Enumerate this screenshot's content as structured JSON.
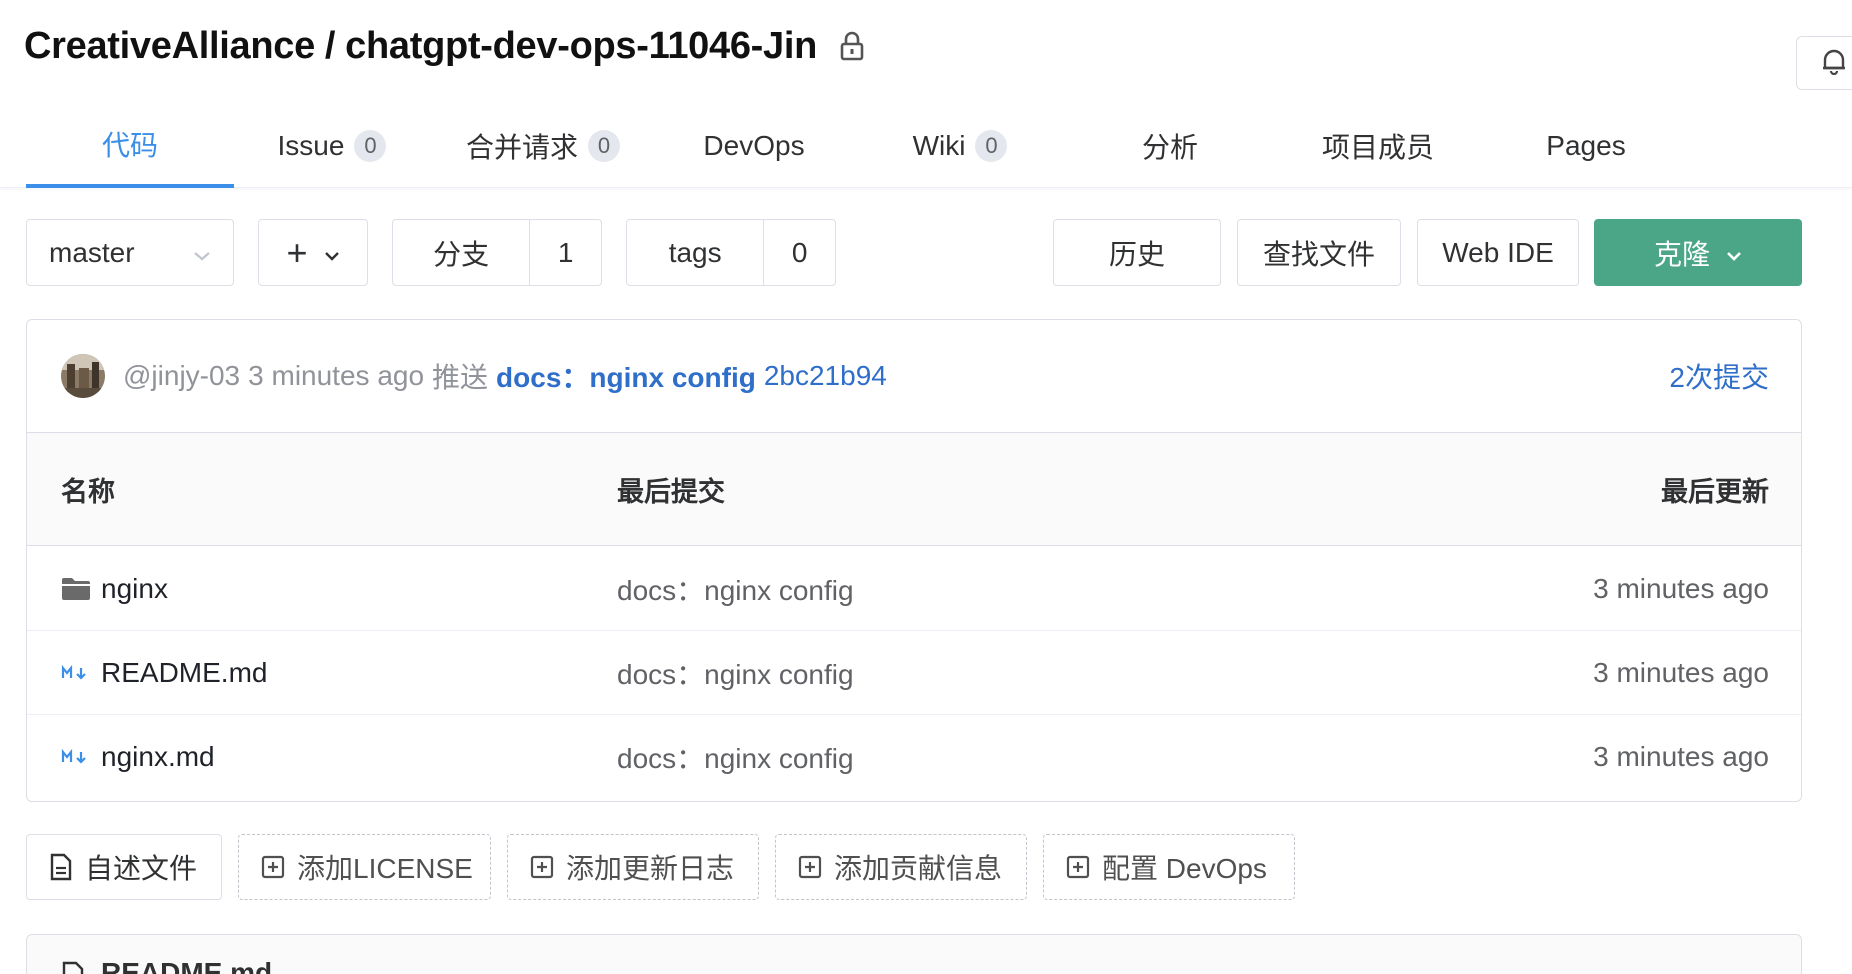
{
  "header": {
    "owner": "CreativeAlliance",
    "separator": "/",
    "repo": "chatgpt-dev-ops-11046-Jin",
    "icons": {
      "lock": "lock-icon",
      "bell": "bell-icon"
    }
  },
  "tabs": [
    {
      "label": "代码",
      "active": true
    },
    {
      "label": "Issue",
      "count": "0"
    },
    {
      "label": "合并请求",
      "count": "0"
    },
    {
      "label": "DevOps"
    },
    {
      "label": "Wiki",
      "count": "0"
    },
    {
      "label": "分析"
    },
    {
      "label": "项目成员"
    },
    {
      "label": "Pages"
    }
  ],
  "toolbar": {
    "branch": "master",
    "add_label": "+",
    "branches_label": "分支",
    "branches_count": "1",
    "tags_label": "tags",
    "tags_count": "0",
    "history": "历史",
    "find_file": "查找文件",
    "web_ide": "Web IDE",
    "clone": "克隆"
  },
  "latest_commit": {
    "author": "@jinjy-03",
    "time": "3 minutes ago",
    "verb": "推送",
    "message": "docs：nginx config",
    "sha": "2bc21b94",
    "commit_count": "2次提交"
  },
  "table": {
    "headers": {
      "name": "名称",
      "last_commit": "最后提交",
      "last_update": "最后更新"
    },
    "rows": [
      {
        "icon": "folder-icon",
        "name": "nginx",
        "commit": "docs：nginx config",
        "time": "3 minutes ago"
      },
      {
        "icon": "markdown-icon",
        "name": "README.md",
        "commit": "docs：nginx config",
        "time": "3 minutes ago"
      },
      {
        "icon": "markdown-icon",
        "name": "nginx.md",
        "commit": "docs：nginx config",
        "time": "3 minutes ago"
      }
    ]
  },
  "actions": {
    "readme": "自述文件",
    "add_license": "添加LICENSE",
    "add_changelog": "添加更新日志",
    "add_contributing": "添加贡献信息",
    "config_devops": "配置 DevOps"
  },
  "readme_panel": {
    "title": "README.md"
  },
  "colors": {
    "accent": "#3b8fe8",
    "link": "#2f6ec9",
    "clone_green": "#4aa687",
    "muted": "#909399"
  }
}
